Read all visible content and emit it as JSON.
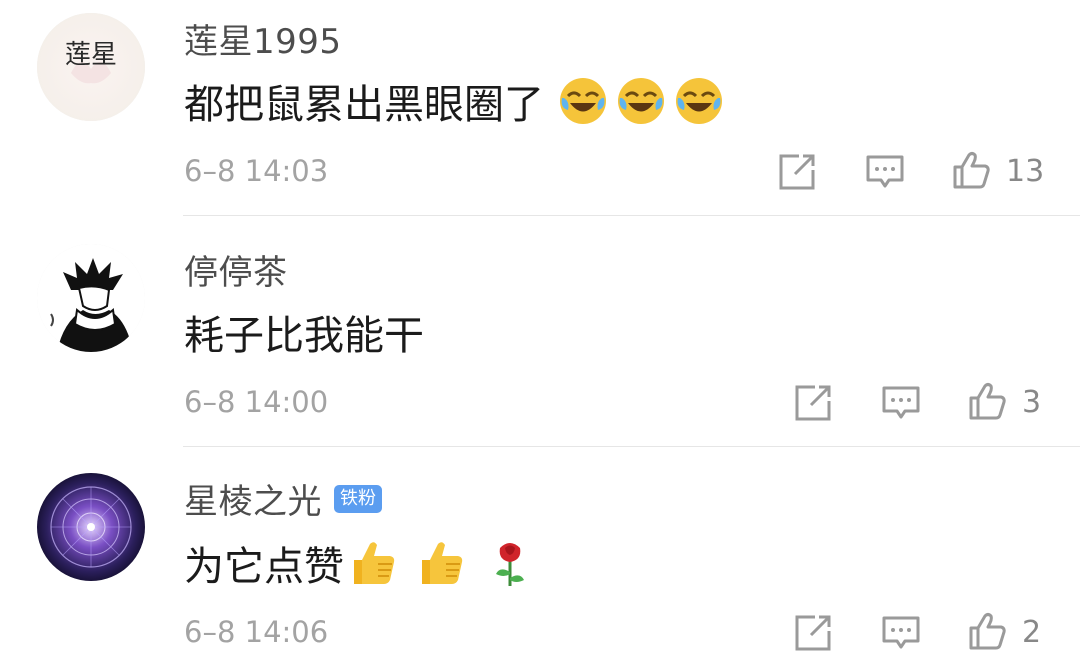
{
  "comments": [
    {
      "username": "莲星1995",
      "avatar_text": "莲星",
      "text": "都把鼠累出黑眼圈了",
      "emojis": [
        "laugh-cry-emoji",
        "laugh-cry-emoji",
        "laugh-cry-emoji"
      ],
      "time": "6–8 14:03",
      "likes": "13"
    },
    {
      "username": "停停茶",
      "text": "耗子比我能干",
      "emojis": [],
      "time": "6–8 14:00",
      "likes": "3"
    },
    {
      "username": "星棱之光",
      "badge": "铁粉",
      "text": "为它点赞",
      "emojis": [
        "thumbs-up-emoji",
        "thumbs-up-emoji",
        "rose-emoji"
      ],
      "time": "6–8 14:06",
      "likes": "2"
    }
  ],
  "colors": {
    "username": "#4d4d4d",
    "text": "#1b1b1b",
    "meta": "#a3a3a3",
    "badge": "#5b9df0",
    "divider": "#e6e6e6"
  },
  "icons": [
    "share-icon",
    "comment-icon",
    "like-icon"
  ]
}
